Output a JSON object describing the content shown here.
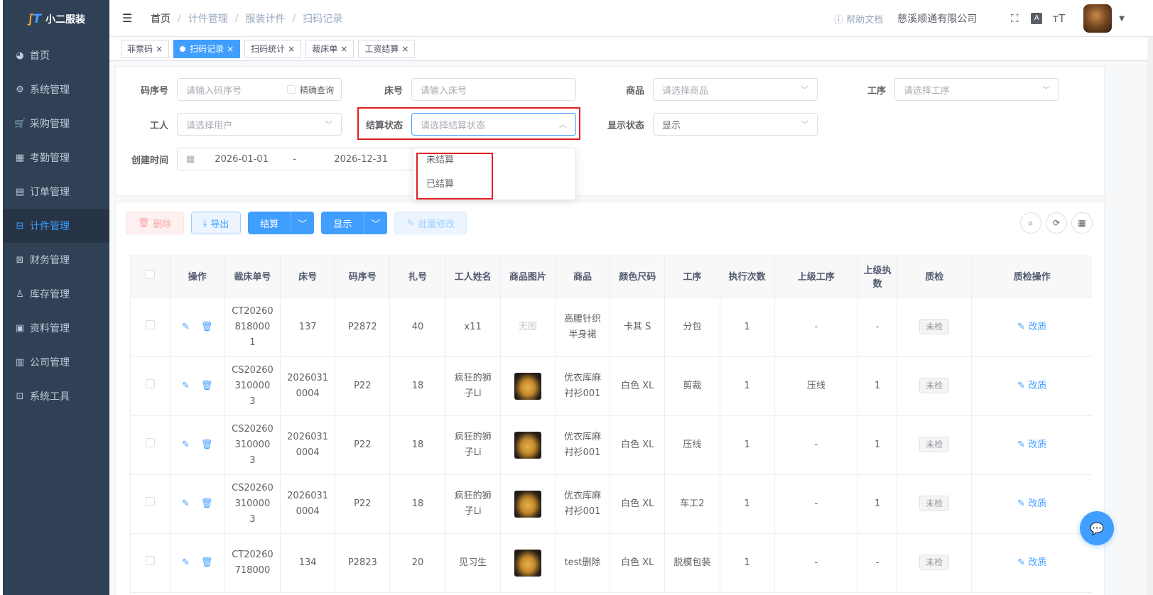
{
  "app": {
    "name": "小二服装"
  },
  "sidebar": {
    "items": [
      {
        "label": "首页",
        "icon": "dashboard-icon"
      },
      {
        "label": "系统管理",
        "icon": "gear-icon"
      },
      {
        "label": "采购管理",
        "icon": "cart-icon"
      },
      {
        "label": "考勤管理",
        "icon": "grid-icon"
      },
      {
        "label": "订单管理",
        "icon": "order-icon"
      },
      {
        "label": "计件管理",
        "icon": "book-icon",
        "active": true
      },
      {
        "label": "财务管理",
        "icon": "chart-icon"
      },
      {
        "label": "库存管理",
        "icon": "user-icon"
      },
      {
        "label": "资料管理",
        "icon": "document-icon"
      },
      {
        "label": "公司管理",
        "icon": "bar-chart-icon"
      },
      {
        "label": "系统工具",
        "icon": "toolbox-icon"
      }
    ]
  },
  "navbar": {
    "breadcrumb": [
      "首页",
      "计件管理",
      "服装计件",
      "扫码记录"
    ],
    "help": "帮助文档",
    "company": "慈溪顺通有限公司"
  },
  "tags": [
    {
      "label": "菲票码",
      "active": false
    },
    {
      "label": "扫码记录",
      "active": true
    },
    {
      "label": "扫码统计",
      "active": false
    },
    {
      "label": "裁床单",
      "active": false
    },
    {
      "label": "工资结算",
      "active": false
    }
  ],
  "search": {
    "code_label": "码序号",
    "code_placeholder": "请输入码序号",
    "precise_label": "精确查询",
    "bed_label": "床号",
    "bed_placeholder": "请输入床号",
    "product_label": "商品",
    "product_placeholder": "请选择商品",
    "process_label": "工序",
    "process_placeholder": "请选择工序",
    "worker_label": "工人",
    "worker_placeholder": "请选择用户",
    "settle_label": "结算状态",
    "settle_placeholder": "请选择结算状态",
    "display_label": "显示状态",
    "display_value": "显示",
    "created_label": "创建时间",
    "date_start": "2026-01-01",
    "date_sep": "-",
    "date_end": "2026-12-31"
  },
  "settle_dropdown": {
    "options": [
      "未结算",
      "已结算"
    ]
  },
  "toolbar": {
    "delete": "删除",
    "export": "导出",
    "settle": "结算",
    "display": "显示",
    "batch_edit": "批量修改"
  },
  "table": {
    "headers": [
      "",
      "操作",
      "裁床单号",
      "床号",
      "码序号",
      "扎号",
      "工人姓名",
      "商品图片",
      "商品",
      "颜色尺码",
      "工序",
      "执行次数",
      "上级工序",
      "上级执数",
      "质检",
      "质检操作"
    ],
    "rows": [
      {
        "cut_no": "CT20260818000 1",
        "bed": "137",
        "code": "P2872",
        "bundle": "40",
        "worker": "x11",
        "image": "无图",
        "product": "高腰针织半身裙",
        "color_size": "卡其 S",
        "process": "分包",
        "count": "1",
        "parent_process": "-",
        "parent_count": "-",
        "qc": "未检",
        "qc_action": "改质"
      },
      {
        "cut_no": "CS20260310000 3",
        "bed": "20260310004",
        "code": "P22",
        "bundle": "18",
        "worker": "疯狂的狮子Li",
        "image": "",
        "product": "优衣库麻衬衫001",
        "color_size": "白色 XL",
        "process": "剪裁",
        "count": "1",
        "parent_process": "压线",
        "parent_count": "1",
        "qc": "未检",
        "qc_action": "改质"
      },
      {
        "cut_no": "CS20260310000 3",
        "bed": "20260310004",
        "code": "P22",
        "bundle": "18",
        "worker": "疯狂的狮子Li",
        "image": "",
        "product": "优衣库麻衬衫001",
        "color_size": "白色 XL",
        "process": "压线",
        "count": "1",
        "parent_process": "-",
        "parent_count": "1",
        "qc": "未检",
        "qc_action": "改质"
      },
      {
        "cut_no": "CS20260310000 3",
        "bed": "20260310004",
        "code": "P22",
        "bundle": "18",
        "worker": "疯狂的狮子Li",
        "image": "",
        "product": "优衣库麻衬衫001",
        "color_size": "白色 XL",
        "process": "车工2",
        "count": "1",
        "parent_process": "-",
        "parent_count": "1",
        "qc": "未检",
        "qc_action": "改质"
      },
      {
        "cut_no": "CT20260718000",
        "bed": "134",
        "code": "P2823",
        "bundle": "20",
        "worker": "见习生",
        "image": "",
        "product": "test删除",
        "color_size": "白色 XL",
        "process": "脱模包装",
        "count": "1",
        "parent_process": "-",
        "parent_count": "-",
        "qc": "未检",
        "qc_action": "改质"
      }
    ]
  },
  "colors": {
    "primary": "#409eff",
    "sidebar_bg": "#304156",
    "danger_box": "#e02020"
  }
}
